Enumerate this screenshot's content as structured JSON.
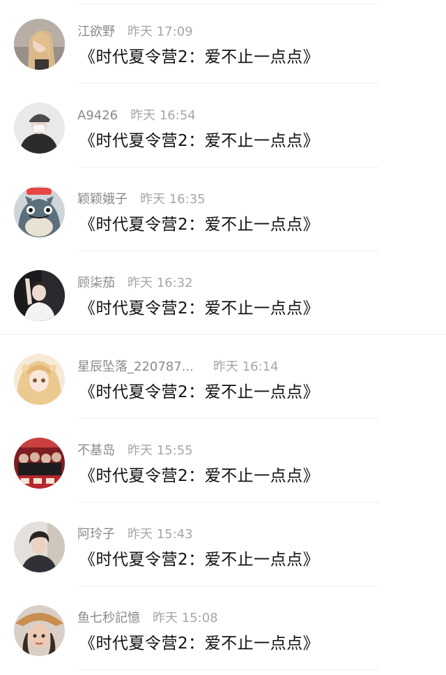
{
  "comments": [
    {
      "user": "江欲野",
      "time": "昨天 17:09",
      "text": "《时代夏令营2：爱不止一点点》",
      "avatar_icon": "blonde-girl-portrait"
    },
    {
      "user": "A9426",
      "time": "昨天 16:54",
      "text": "《时代夏令营2：爱不止一点点》",
      "avatar_icon": "cap-mask-person"
    },
    {
      "user": "颖颖娥子",
      "time": "昨天 16:35",
      "text": "《时代夏令营2：爱不止一点点》",
      "avatar_icon": "totoro-character"
    },
    {
      "user": "顾柒茄",
      "time": "昨天 16:32",
      "text": "《时代夏令营2：爱不止一点点》",
      "avatar_icon": "waving-boy"
    },
    {
      "user": "星辰坠落_220787...",
      "time": "昨天 16:14",
      "text": "《时代夏令营2：爱不止一点点》",
      "avatar_icon": "anime-blonde-girl"
    },
    {
      "user": "不基岛",
      "time": "昨天 15:55",
      "text": "《时代夏令营2：爱不止一点点》",
      "avatar_icon": "group-photo-red"
    },
    {
      "user": "阿玲子",
      "time": "昨天 15:43",
      "text": "《时代夏令营2：爱不止一点点》",
      "avatar_icon": "young-man-portrait"
    },
    {
      "user": "鱼七秒記憶",
      "time": "昨天 15:08",
      "text": "《时代夏令营2：爱不止一点点》",
      "avatar_icon": "straw-hat-person"
    }
  ]
}
